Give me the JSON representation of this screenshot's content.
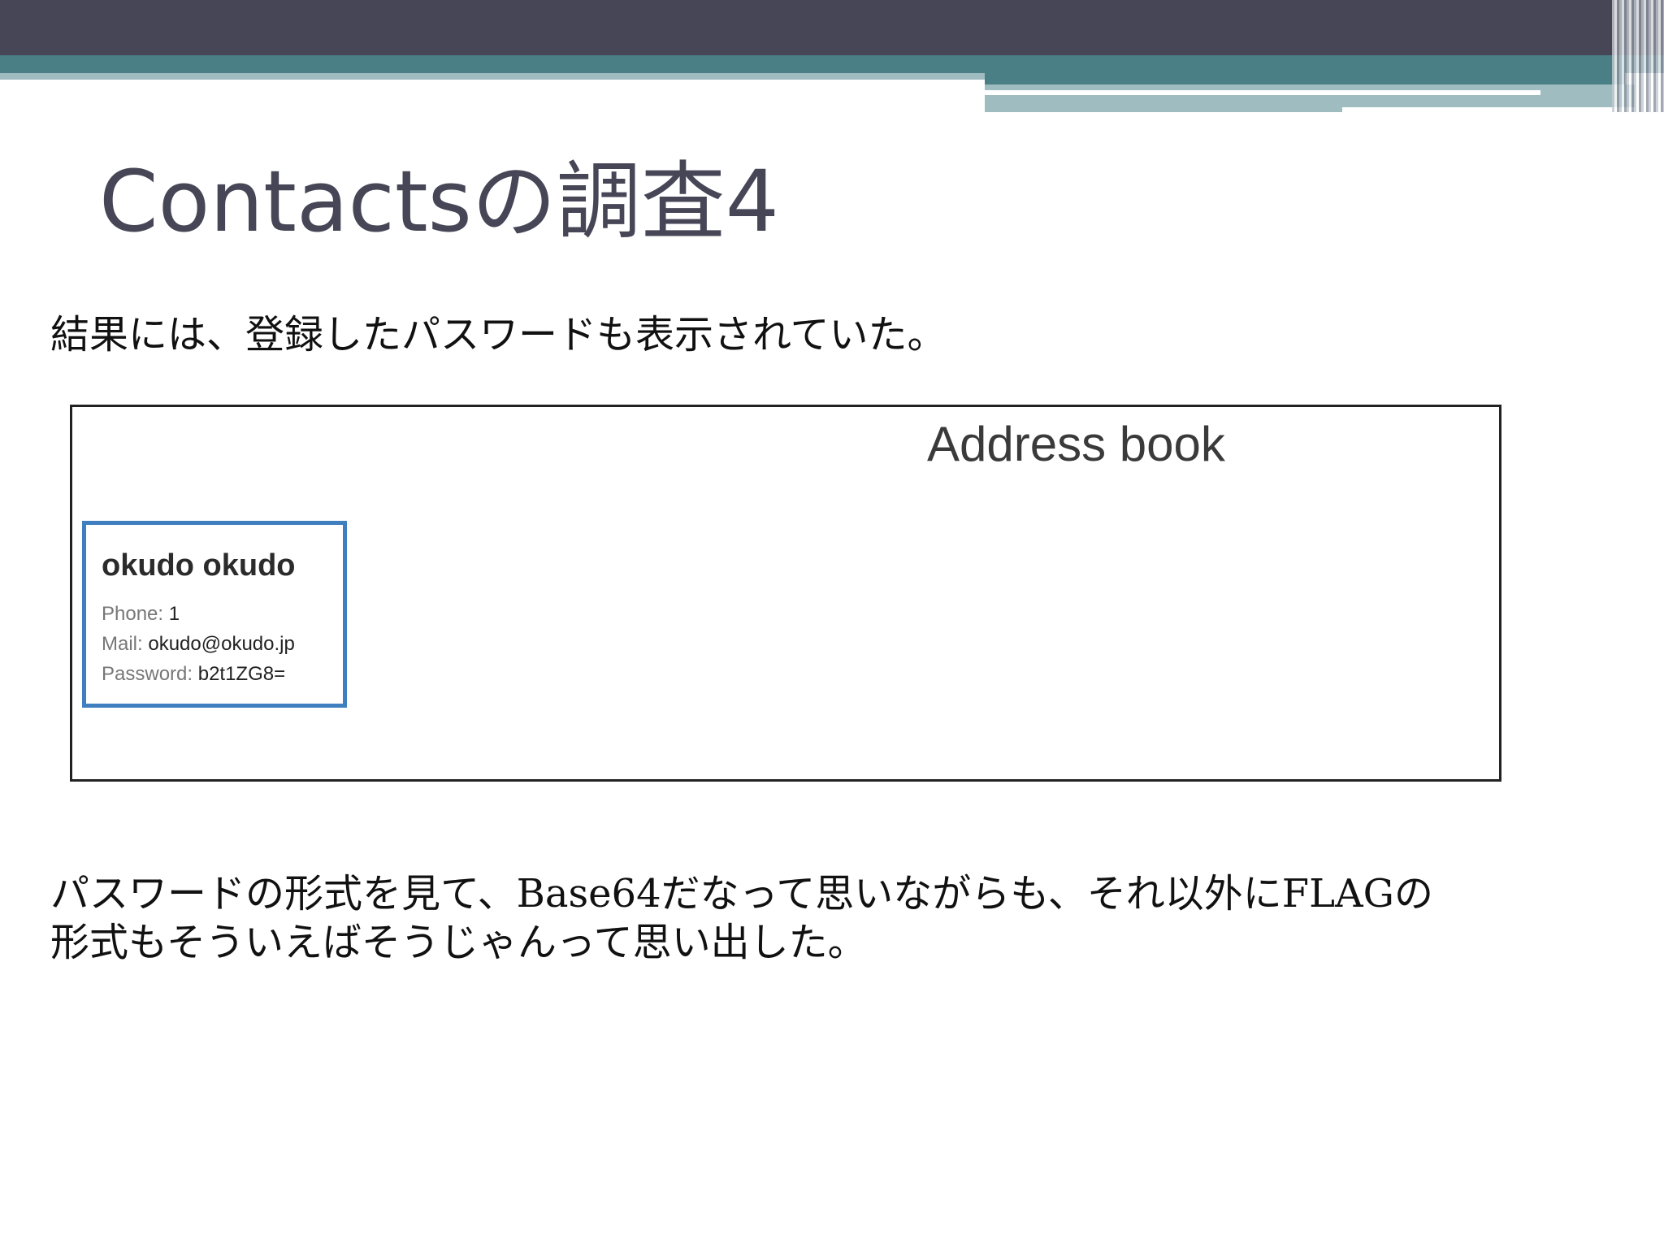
{
  "slide": {
    "title": "Contactsの調査4",
    "paragraph1": "結果には、登録したパスワードも表示されていた。",
    "paragraph2_line1": "パスワードの形式を見て、Base64だなって思いながらも、それ以外にFLAGの",
    "paragraph2_line2": "形式もそういえばそうじゃんって思い出した。"
  },
  "screenshot": {
    "heading": "Address book",
    "contact": {
      "name": "okudo okudo",
      "phone_label": "Phone: ",
      "phone_value": "1",
      "mail_label": "Mail: ",
      "mail_value": "okudo@okudo.jp",
      "password_label": "Password: ",
      "password_value": "b2t1ZG8="
    }
  },
  "colors": {
    "header_dark": "#464657",
    "header_teal": "#4a7f86",
    "header_light": "#9fbcc0",
    "card_border": "#3f7fbf"
  }
}
